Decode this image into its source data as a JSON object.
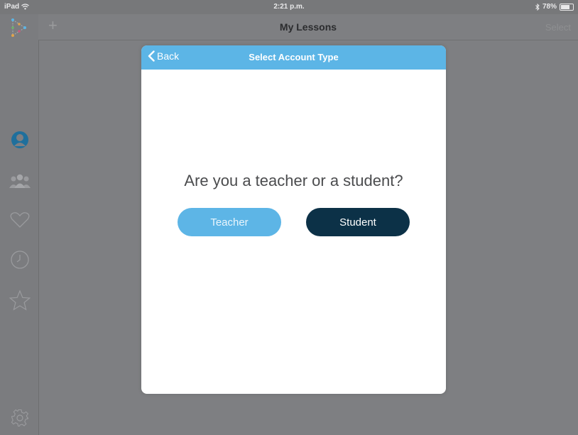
{
  "statusbar": {
    "device": "iPad",
    "time": "2:21 p.m.",
    "battery": "78%",
    "battery_level": 0.78
  },
  "navbar": {
    "title": "My Lessons",
    "add_label": "+",
    "select_label": "Select"
  },
  "sidebar": {
    "items": [
      {
        "icon": "logo-icon"
      },
      {
        "icon": "profile-icon"
      },
      {
        "icon": "group-icon"
      },
      {
        "icon": "heart-icon"
      },
      {
        "icon": "clock-icon"
      },
      {
        "icon": "star-icon"
      },
      {
        "icon": "gear-icon"
      }
    ]
  },
  "modal": {
    "back_label": "Back",
    "title": "Select Account Type",
    "question": "Are you a teacher or a student?",
    "teacher_label": "Teacher",
    "student_label": "Student"
  },
  "colors": {
    "header": "#5cb5e6",
    "teacher_button": "#5db5e6",
    "student_button": "#0c3147",
    "overlay": "#7e7f82"
  }
}
